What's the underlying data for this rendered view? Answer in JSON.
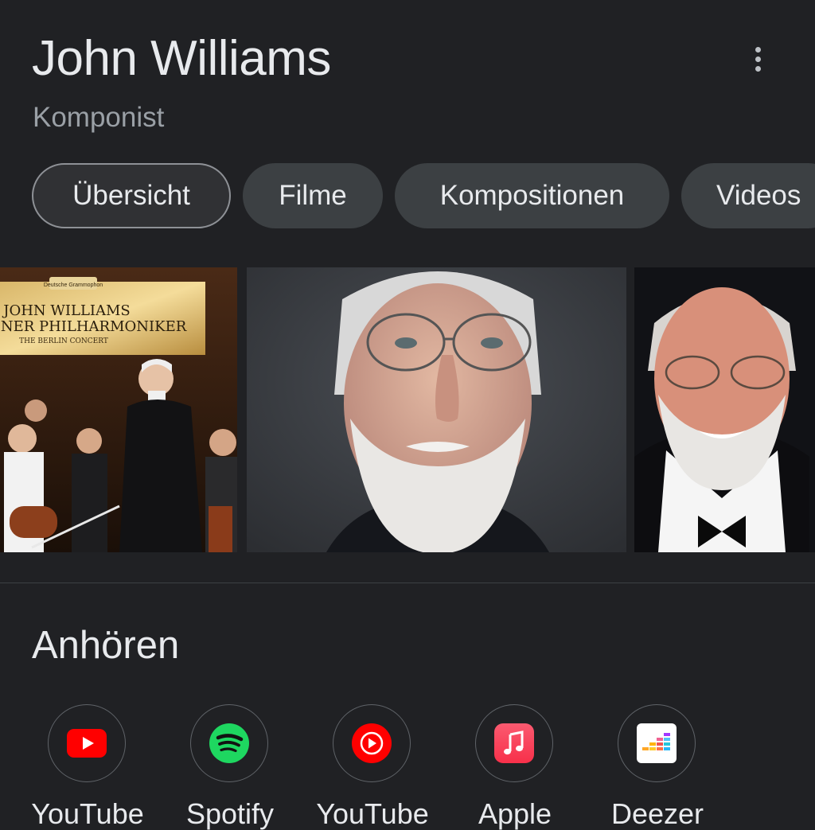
{
  "header": {
    "title": "John Williams",
    "subtitle": "Komponist",
    "more_icon": "more-vert-icon"
  },
  "tabs": [
    {
      "label": "Übersicht",
      "active": true
    },
    {
      "label": "Filme",
      "active": false
    },
    {
      "label": "Kompositionen",
      "active": false
    },
    {
      "label": "Videos",
      "active": false
    }
  ],
  "images": [
    {
      "name": "album-cover-image",
      "album_lines": [
        "Deutsche Grammophon",
        "JOHN WILLIAMS",
        "INER PHILHARMONIKER",
        "THE BERLIN CONCERT"
      ]
    },
    {
      "name": "portrait-closeup-image"
    },
    {
      "name": "portrait-smiling-image"
    }
  ],
  "listen": {
    "title": "Anhören",
    "services": [
      {
        "label": "YouTube",
        "icon": "youtube-icon",
        "color": "#ff0000"
      },
      {
        "label": "Spotify",
        "icon": "spotify-icon",
        "color": "#1ed760"
      },
      {
        "label": "YouTube",
        "icon": "youtube-music-icon",
        "color": "#ff0000"
      },
      {
        "label": "Apple",
        "icon": "apple-music-icon",
        "color": "#fa3c55"
      },
      {
        "label": "Deezer",
        "icon": "deezer-icon",
        "color": "#ffffff"
      }
    ]
  },
  "colors": {
    "background": "#202124",
    "chip": "#3c4043",
    "chip_active_border": "#8e9196",
    "text_primary": "#e8eaed",
    "text_secondary": "#9aa0a6"
  }
}
